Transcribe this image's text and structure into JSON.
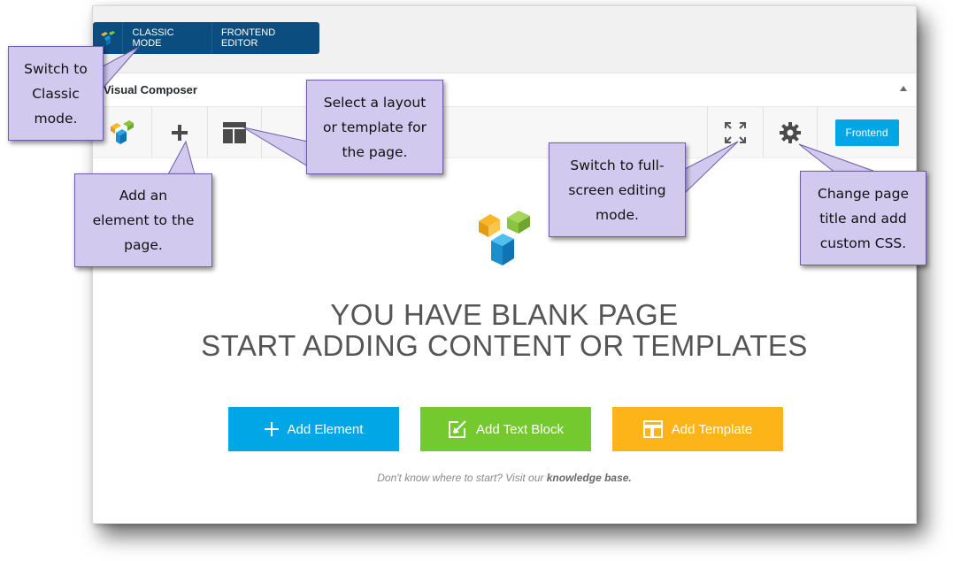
{
  "mode_bar": {
    "classic_label": "CLASSIC MODE",
    "frontend_label": "FRONTEND EDITOR"
  },
  "composer": {
    "title": "Visual Composer",
    "frontend_button": "Frontend"
  },
  "blank_page": {
    "headline_1": "YOU HAVE BLANK PAGE",
    "headline_2": "START ADDING CONTENT OR TEMPLATES",
    "add_element": "Add Element",
    "add_text_block": "Add Text Block",
    "add_template": "Add Template",
    "hint_prefix": "Don't know where to start? Visit our",
    "hint_link": "knowledge base."
  },
  "callouts": {
    "classic": [
      "Switch to",
      "Classic",
      "mode."
    ],
    "add_element": [
      "Add an",
      "element to the",
      "page."
    ],
    "layout": [
      "Select a layout",
      "or template for",
      "the page."
    ],
    "fullscreen": [
      "Switch to full-",
      "screen editing",
      "mode."
    ],
    "settings": [
      "Change page",
      "title and add",
      "custom CSS."
    ]
  },
  "colors": {
    "mode_bar": "#0c4d7f",
    "add_element_button": "#00a6e6",
    "add_text_block_button": "#74c92f",
    "add_template_button": "#fdb418",
    "callout_fill": "#d2c9ef",
    "callout_border": "#6c5da6"
  },
  "icons": {
    "mode_logo": "vc-logo-icon",
    "toolbar_logo": "vc-logo-icon",
    "add": "plus-icon",
    "layout": "layout-template-icon",
    "fullscreen": "fullscreen-icon",
    "settings": "gear-icon",
    "add_element_button": "plus-icon",
    "add_text_block_button": "edit-icon",
    "add_template_button": "template-icon"
  }
}
